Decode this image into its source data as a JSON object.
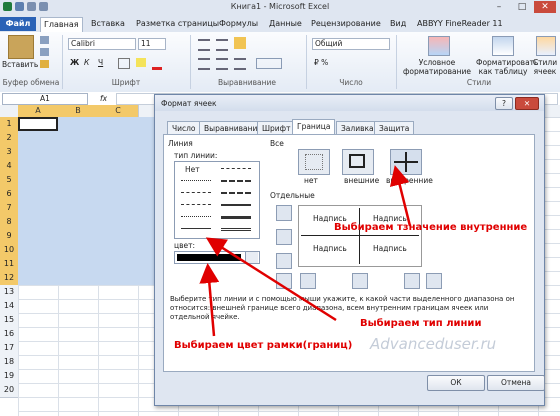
{
  "window": {
    "title": "Книга1 - Microsoft Excel",
    "minimize_glyph": "–",
    "maximize_glyph": "□",
    "close_glyph": "✕"
  },
  "ribbon_tabs": [
    "Файл",
    "Главная",
    "Вставка",
    "Разметка страницы",
    "Формулы",
    "Данные",
    "Рецензирование",
    "Вид",
    "ABBYY FineReader 11"
  ],
  "ribbon": {
    "paste_label": "Вставить",
    "font_name": "Calibri",
    "font_size": "11",
    "bold": "Ж",
    "italic": "К",
    "underline": "Ч",
    "number_format": "Общий",
    "cond_format": "Условное форматирование",
    "table_format": "Форматировать как таблицу",
    "cell_styles": "Стили ячеек",
    "groups": [
      "Буфер обмена",
      "Шрифт",
      "Выравнивание",
      "Число",
      "Стили"
    ]
  },
  "formula_bar": {
    "name_box": "A1",
    "fx": "fx"
  },
  "sheet": {
    "columns": [
      "A",
      "B",
      "C"
    ],
    "rows": [
      "1",
      "2",
      "3",
      "4",
      "5",
      "6",
      "7",
      "8",
      "9",
      "10",
      "11",
      "12",
      "13",
      "14",
      "15",
      "16",
      "17",
      "18",
      "19",
      "20"
    ]
  },
  "dialog": {
    "title": "Формат ячеек",
    "help": "?",
    "close": "✕",
    "tabs": [
      "Число",
      "Выравнивание",
      "Шрифт",
      "Граница",
      "Заливка",
      "Защита"
    ],
    "active_tab": "Граница",
    "line_group": "Линия",
    "line_type_label": "тип линии:",
    "line_none": "Нет",
    "color_label": "цвет:",
    "presets_group": "Все",
    "presets": [
      "нет",
      "внешние",
      "внутренние"
    ],
    "individual_group": "Отдельные",
    "preview_cells": [
      "Надпись",
      "Надпись",
      "Надпись",
      "Надпись"
    ],
    "hint": "Выберите тип линии и с помощью мыши укажите, к какой части выделенного диапазона он относится: внешней границе всего диапазона, всем внутренним границам ячеек или отдельной ячейке.",
    "ok": "ОК",
    "cancel": "Отмена",
    "watermark": "Advanceduser.ru"
  },
  "annotations": {
    "inner": "Выбираем тзначение внутренние",
    "line_type": "Выбираем тип линии",
    "color": "Выбираем цвет рамки(границ)",
    "color_hex": "#e00000"
  }
}
